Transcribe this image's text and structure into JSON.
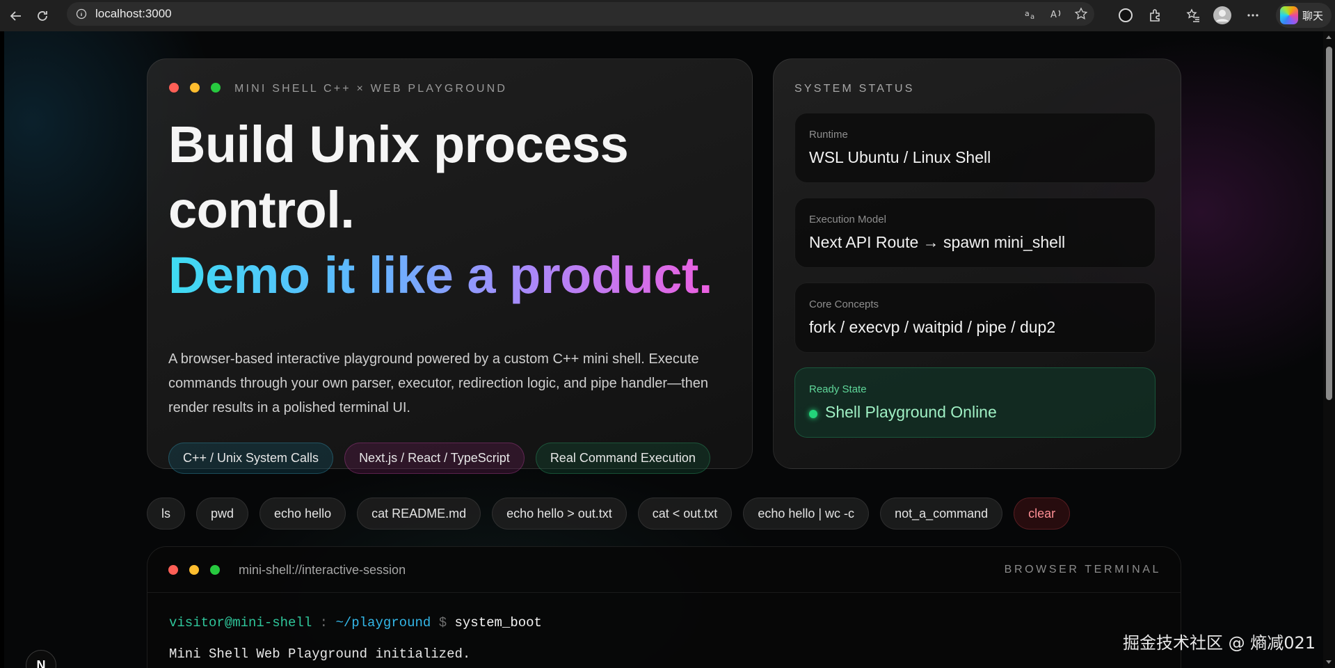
{
  "browser": {
    "url": "localhost:3000",
    "copilot_label": "聊天"
  },
  "hero": {
    "eyebrow": "MINI SHELL C++ × WEB PLAYGROUND",
    "headline_line1": "Build Unix process",
    "headline_line2": "control.",
    "headline_line3": "Demo it like a product.",
    "description": "A browser-based interactive playground powered by a custom C++ mini shell. Execute commands through your own parser, executor, redirection logic, and pipe handler—then render results in a polished terminal UI.",
    "tags": [
      "C++ / Unix System Calls",
      "Next.js / React / TypeScript",
      "Real Command Execution"
    ]
  },
  "status": {
    "title": "SYSTEM STATUS",
    "items": [
      {
        "label": "Runtime",
        "value": "WSL Ubuntu / Linux Shell"
      },
      {
        "label": "Execution Model",
        "value": "Next API Route → spawn mini_shell"
      },
      {
        "label": "Core Concepts",
        "value": "fork / execvp / waitpid / pipe / dup2"
      },
      {
        "label": "Ready State",
        "value": "Shell Playground Online"
      }
    ]
  },
  "commands": [
    "ls",
    "pwd",
    "echo hello",
    "cat README.md",
    "echo hello > out.txt",
    "cat < out.txt",
    "echo hello | wc -c",
    "not_a_command",
    "clear"
  ],
  "terminal": {
    "session": "mini-shell://interactive-session",
    "kind": "BROWSER TERMINAL",
    "prompt_user": "visitor@mini-shell",
    "prompt_sep": ":",
    "prompt_path": "~/playground",
    "prompt_symbol": "$",
    "command": "system_boot",
    "output": "Mini Shell Web Playground initialized."
  },
  "overlay": {
    "next_badge": "N",
    "watermark": "掘金技术社区 @ 熵减021"
  },
  "colors": {
    "accent_cyan": "#3fdcf2",
    "accent_violet": "#a78bfa",
    "accent_pink": "#ec5fe0",
    "ready_green": "#23d37a",
    "danger_red": "#ff8f95"
  }
}
